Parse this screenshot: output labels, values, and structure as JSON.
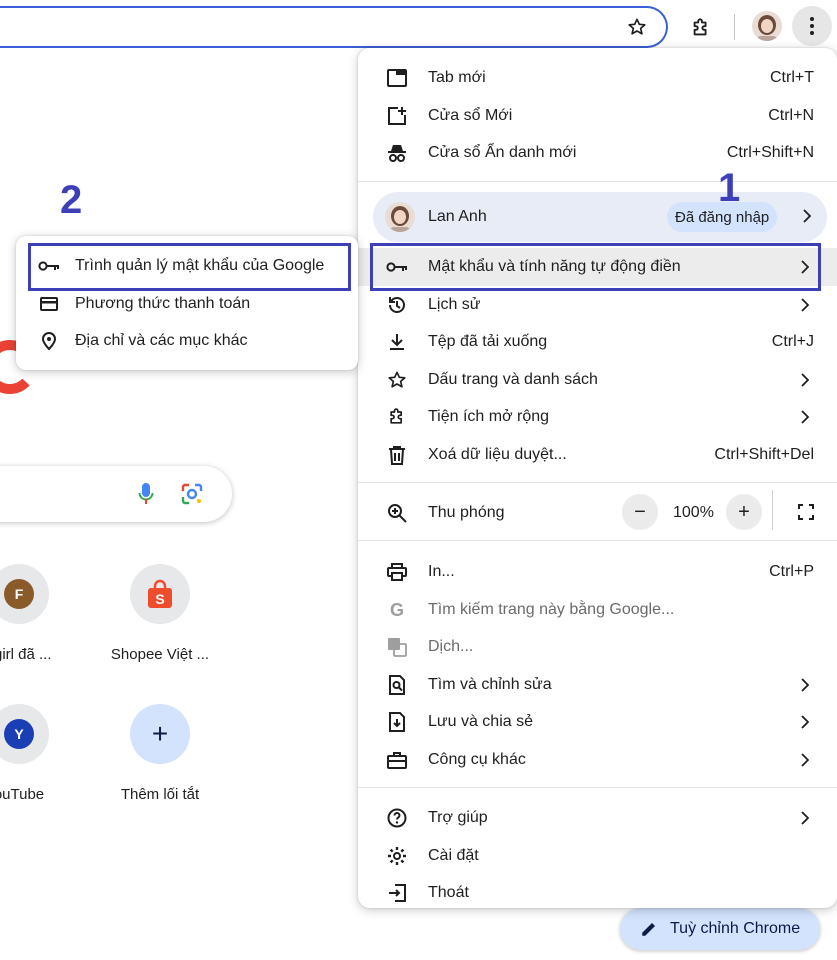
{
  "menu": {
    "new_tab": "Tab mới",
    "new_tab_sc": "Ctrl+T",
    "new_window": "Cửa sổ Mới",
    "new_window_sc": "Ctrl+N",
    "incognito": "Cửa sổ Ẩn danh mới",
    "incognito_sc": "Ctrl+Shift+N",
    "profile_name": "Lan Anh",
    "profile_badge": "Đã đăng nhập",
    "passwords": "Mật khẩu và tính năng tự động điền",
    "history": "Lịch sử",
    "downloads": "Tệp đã tải xuống",
    "downloads_sc": "Ctrl+J",
    "bookmarks": "Dấu trang và danh sách",
    "extensions": "Tiện ích mở rộng",
    "clear_data": "Xoá dữ liệu duyệt...",
    "clear_data_sc": "Ctrl+Shift+Del",
    "zoom": "Thu phóng",
    "zoom_minus": "−",
    "zoom_value": "100%",
    "zoom_plus": "+",
    "print": "In...",
    "print_sc": "Ctrl+P",
    "search_google": "Tìm kiếm trang này bằng Google...",
    "translate": "Dịch...",
    "find_edit": "Tìm và chỉnh sửa",
    "save_share": "Lưu và chia sẻ",
    "more_tools": "Công cụ khác",
    "help": "Trợ giúp",
    "settings": "Cài đặt",
    "exit": "Thoát"
  },
  "submenu": {
    "password_manager": "Trình quản lý mật khẩu của Google",
    "payment": "Phương thức thanh toán",
    "addresses": "Địa chỉ và các mục khác"
  },
  "ntp": {
    "tiles": [
      {
        "letter": "F",
        "label": "l girl đã ..."
      },
      {
        "letter": "S",
        "label": "Shopee Việt ..."
      },
      {
        "letter": "Y",
        "label": "ouTube"
      },
      {
        "letter": "+",
        "label": "Thêm lối tắt"
      }
    ],
    "customize": "Tuỳ chỉnh Chrome"
  },
  "annotations": {
    "one": "1",
    "two": "2"
  },
  "colors": {
    "annotation": "#3d3fb8",
    "accent": "#3b5fd6",
    "badge": "#d3e3fd"
  }
}
